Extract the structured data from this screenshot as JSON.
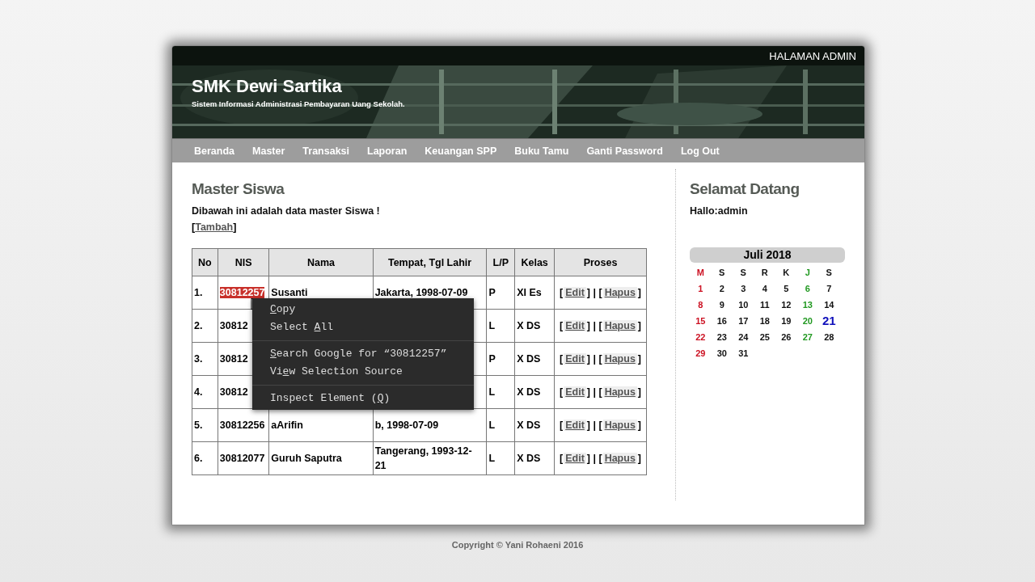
{
  "top_bar": {
    "label": "HALAMAN ADMIN"
  },
  "header": {
    "title": "SMK Dewi Sartika",
    "subtitle": "Sistem Informasi Administrasi Pembayaran Uang Sekolah."
  },
  "nav": [
    "Beranda",
    "Master",
    "Transaksi",
    "Laporan",
    "Keuangan SPP",
    "Buku Tamu",
    "Ganti Password",
    "Log Out"
  ],
  "main": {
    "title": "Master Siswa",
    "intro": "Dibawah ini adalah data master Siswa !",
    "add_link": {
      "open": "[",
      "label": "Tambah",
      "close": "]"
    },
    "table": {
      "columns": [
        "No",
        "NIS",
        "Nama",
        "Tempat, Tgl Lahir",
        "L/P",
        "Kelas",
        "Proses"
      ],
      "rows": [
        {
          "no": "1.",
          "nis": "30812257",
          "nis_selected": true,
          "nama": "Susanti",
          "tempat": "Jakarta, 1998-07-09",
          "lp": "P",
          "kelas": "XI Es",
          "proses": [
            {
              "kind": "text",
              "text": "["
            },
            {
              "kind": "link",
              "text": "Edit"
            },
            {
              "kind": "text",
              "text": "] | ["
            },
            {
              "kind": "link",
              "text": "Hapus"
            },
            {
              "kind": "text",
              "text": "]"
            }
          ]
        },
        {
          "no": "2.",
          "nis": "30812",
          "nis_selected": false,
          "lp": "L",
          "kelas": "X DS",
          "proses": [
            {
              "kind": "text",
              "text": "["
            },
            {
              "kind": "link",
              "text": "Edit"
            },
            {
              "kind": "text",
              "text": "] | ["
            },
            {
              "kind": "link",
              "text": "Hapus"
            },
            {
              "kind": "text",
              "text": "]"
            }
          ]
        },
        {
          "no": "3.",
          "nis": "30812",
          "nis_selected": false,
          "lp": "P",
          "kelas": "X DS",
          "proses": [
            {
              "kind": "text",
              "text": "["
            },
            {
              "kind": "link",
              "text": "Edit"
            },
            {
              "kind": "text",
              "text": "] | ["
            },
            {
              "kind": "link",
              "text": "Hapus"
            },
            {
              "kind": "text",
              "text": "]"
            }
          ]
        },
        {
          "no": "4.",
          "nis": "30812",
          "nis_selected": false,
          "lp": "L",
          "kelas": "X DS",
          "proses": [
            {
              "kind": "text",
              "text": "["
            },
            {
              "kind": "link",
              "text": "Edit"
            },
            {
              "kind": "text",
              "text": "] | ["
            },
            {
              "kind": "link",
              "text": "Hapus"
            },
            {
              "kind": "text",
              "text": "]"
            }
          ]
        },
        {
          "no": "5.",
          "nis": "30812256",
          "nis_selected": false,
          "nama": "aArifin",
          "tempat": "b, 1998-07-09",
          "lp": "L",
          "kelas": "X DS",
          "proses": [
            {
              "kind": "text",
              "text": "["
            },
            {
              "kind": "link",
              "text": "Edit"
            },
            {
              "kind": "text",
              "text": "] | ["
            },
            {
              "kind": "link",
              "text": "Hapus"
            },
            {
              "kind": "text",
              "text": "]"
            }
          ]
        },
        {
          "no": "6.",
          "nis": "30812077",
          "nis_selected": false,
          "nama": "Guruh Saputra",
          "tempat": "Tangerang, 1993-12-21",
          "lp": "L",
          "kelas": "X DS",
          "proses": [
            {
              "kind": "text",
              "text": "["
            },
            {
              "kind": "link",
              "text": "Edit"
            },
            {
              "kind": "text",
              "text": "] | ["
            },
            {
              "kind": "link",
              "text": "Hapus"
            },
            {
              "kind": "text",
              "text": "]"
            }
          ]
        }
      ]
    }
  },
  "sidebar": {
    "title": "Selamat Datang",
    "greeting": "Hallo:admin",
    "calendar": {
      "title": "Juli 2018",
      "weekdays": [
        {
          "label": "M",
          "color": "#cc1122"
        },
        {
          "label": "S",
          "color": "#111111"
        },
        {
          "label": "S",
          "color": "#111111"
        },
        {
          "label": "R",
          "color": "#111111"
        },
        {
          "label": "K",
          "color": "#111111"
        },
        {
          "label": "J",
          "color": "#229922"
        },
        {
          "label": "S",
          "color": "#111111"
        }
      ],
      "weeks": [
        [
          {
            "day": "1",
            "selected": false
          },
          {
            "day": "2",
            "selected": false
          },
          {
            "day": "3",
            "selected": false
          },
          {
            "day": "4",
            "selected": false
          },
          {
            "day": "5",
            "selected": false
          },
          {
            "day": "6",
            "selected": false
          },
          {
            "day": "7",
            "selected": false
          }
        ],
        [
          {
            "day": "8",
            "selected": false
          },
          {
            "day": "9",
            "selected": false
          },
          {
            "day": "10",
            "selected": false
          },
          {
            "day": "11",
            "selected": false
          },
          {
            "day": "12",
            "selected": false
          },
          {
            "day": "13",
            "selected": false
          },
          {
            "day": "14",
            "selected": false
          }
        ],
        [
          {
            "day": "15",
            "selected": false
          },
          {
            "day": "16",
            "selected": false
          },
          {
            "day": "17",
            "selected": false
          },
          {
            "day": "18",
            "selected": false
          },
          {
            "day": "19",
            "selected": false
          },
          {
            "day": "20",
            "selected": false
          },
          {
            "day": "21",
            "selected": true
          }
        ],
        [
          {
            "day": "22",
            "selected": false
          },
          {
            "day": "23",
            "selected": false
          },
          {
            "day": "24",
            "selected": false
          },
          {
            "day": "25",
            "selected": false
          },
          {
            "day": "26",
            "selected": false
          },
          {
            "day": "27",
            "selected": false
          },
          {
            "day": "28",
            "selected": false
          }
        ],
        [
          {
            "day": "29",
            "selected": false
          },
          {
            "day": "30",
            "selected": false
          },
          {
            "day": "31",
            "selected": false
          }
        ]
      ]
    }
  },
  "context_menu": {
    "groups": [
      [
        {
          "key": "C",
          "after": "opy"
        },
        {
          "before": "Select ",
          "key": "A",
          "after": "ll"
        }
      ],
      [
        {
          "key": "S",
          "after": "earch Google for “30812257”"
        },
        {
          "before": "Vi",
          "key": "e",
          "after": "w Selection Source"
        }
      ],
      [
        {
          "before": "Inspect Element (",
          "key": "Q",
          "after": ")"
        }
      ]
    ]
  },
  "footer": "Copyright © Yani Rohaeni 2016"
}
